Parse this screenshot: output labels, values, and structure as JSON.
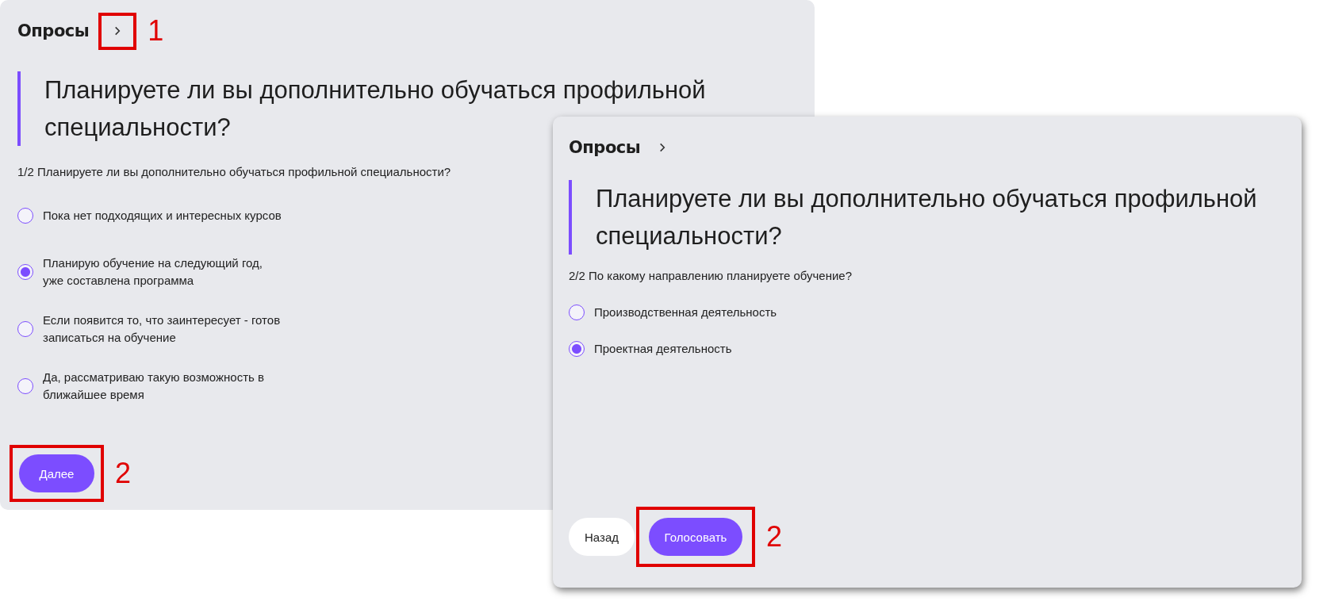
{
  "panels": [
    {
      "title": "Опросы",
      "title_marker": "1",
      "question": "Планируете ли вы дополнительно обучаться профильной специальности?",
      "step": "1/2 Планируете ли вы дополнительно обучаться профильной специальности?",
      "options": [
        {
          "label": "Пока нет подходящих и интересных курсов",
          "selected": false
        },
        {
          "label": "Планирую обучение на следующий год,\nуже составлена программа",
          "selected": true
        },
        {
          "label": "Если появится то, что заинтересует - готов\nзаписаться на обучение",
          "selected": false
        },
        {
          "label": "Да, рассматриваю такую возможность в\nближайшее время",
          "selected": false
        }
      ],
      "buttons": [
        {
          "label": "Далее",
          "kind": "primary",
          "marker": "2"
        }
      ]
    },
    {
      "title": "Опросы",
      "question": "Планируете ли вы дополнительно обучаться профильной специальности?",
      "step": "2/2 По какому направлению планируете обучение?",
      "options": [
        {
          "label": "Производственная деятельность",
          "selected": false
        },
        {
          "label": "Проектная деятельность",
          "selected": true
        }
      ],
      "buttons": [
        {
          "label": "Назад",
          "kind": "secondary"
        },
        {
          "label": "Голосовать",
          "kind": "primary",
          "marker": "2"
        }
      ]
    }
  ]
}
